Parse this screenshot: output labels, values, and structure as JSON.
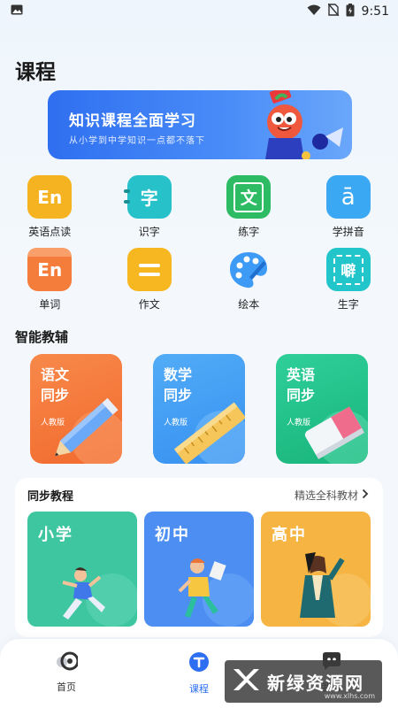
{
  "status_bar": {
    "time": "9:51"
  },
  "page": {
    "title": "课程"
  },
  "banner": {
    "title": "知识课程全面学习",
    "subtitle": "从小学到中学知识一点都不落下"
  },
  "features": [
    {
      "label": "英语点读",
      "icon_text": "En",
      "color": "#f5b321",
      "icon": "english-reading-icon"
    },
    {
      "label": "识字",
      "icon_text": "字",
      "color": "#27c1c9",
      "icon": "character-card-icon"
    },
    {
      "label": "练字",
      "icon_text": "文",
      "color": "#2dbb63",
      "icon": "writing-practice-icon"
    },
    {
      "label": "学拼音",
      "icon_text": "ā",
      "color": "#3aa8f3",
      "icon": "pinyin-icon"
    },
    {
      "label": "单词",
      "icon_text": "En",
      "color": "#f47d3b",
      "icon": "vocabulary-icon"
    },
    {
      "label": "作文",
      "icon_text": "=",
      "color": "#f7b720",
      "icon": "composition-icon"
    },
    {
      "label": "绘本",
      "icon_text": "",
      "color": "#3d9af5",
      "icon": "palette-icon"
    },
    {
      "label": "生字",
      "icon_text": "噼",
      "color": "#22c5c9",
      "icon": "new-character-icon"
    }
  ],
  "smart_tutor": {
    "title": "智能教辅",
    "cards": [
      {
        "title": "语文同步",
        "subtitle": "人教版",
        "color": "#f47b3c"
      },
      {
        "title": "数学同步",
        "subtitle": "人教版",
        "color": "#3c9ff5"
      },
      {
        "title": "英语同步",
        "subtitle": "人教版",
        "color": "#22c08a"
      }
    ]
  },
  "sync_course": {
    "title": "同步教程",
    "more_label": "精选全科教材",
    "items": [
      {
        "title": "小学",
        "color": "#3dc6a0"
      },
      {
        "title": "初中",
        "color": "#4c8ef2"
      },
      {
        "title": "高中",
        "color": "#f6b443"
      }
    ]
  },
  "tabbar": {
    "tabs": [
      {
        "label": "首页",
        "icon": "home-icon",
        "active": false
      },
      {
        "label": "课程",
        "icon": "course-icon",
        "active": true
      },
      {
        "label": "我的",
        "icon": "profile-icon",
        "active": false
      }
    ],
    "accent": "#2d6ff0"
  },
  "watermark": {
    "text": "新绿资源网",
    "url": "www.xlhs.com"
  }
}
